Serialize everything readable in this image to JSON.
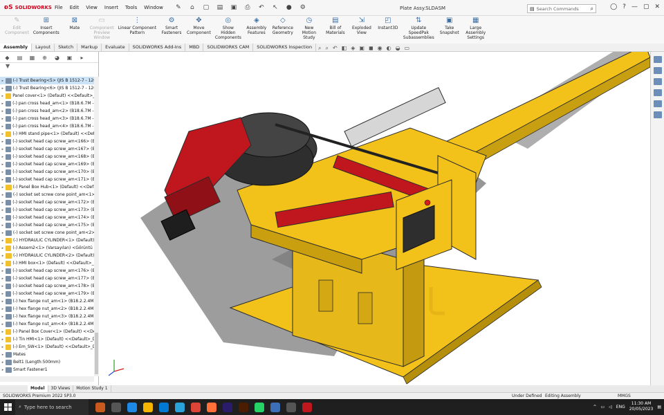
{
  "app": {
    "brand": "SOLIDWORKS",
    "doc_title": "Plate Assy.SLDASM"
  },
  "menus": [
    "File",
    "Edit",
    "View",
    "Insert",
    "Tools",
    "Window"
  ],
  "search": {
    "placeholder": "Search Commands"
  },
  "ribbon": [
    {
      "label": "Edit\nComponent",
      "disabled": true,
      "icon": "edit-component-icon"
    },
    {
      "label": "Insert\nComponents",
      "disabled": false,
      "icon": "insert-components-icon"
    },
    {
      "label": "Mate",
      "disabled": false,
      "icon": "mate-icon"
    },
    {
      "label": "Component\nPreview\nWindow",
      "disabled": true,
      "icon": "preview-window-icon"
    },
    {
      "label": "Linear Component\nPattern",
      "disabled": false,
      "icon": "pattern-icon"
    },
    {
      "label": "Smart\nFasteners",
      "disabled": false,
      "icon": "smart-fasteners-icon"
    },
    {
      "label": "Move\nComponent",
      "disabled": false,
      "icon": "move-component-icon"
    },
    {
      "label": "Show\nHidden\nComponents",
      "disabled": false,
      "icon": "show-hidden-icon"
    },
    {
      "label": "Assembly\nFeatures",
      "disabled": false,
      "icon": "assembly-features-icon"
    },
    {
      "label": "Reference\nGeometry",
      "disabled": false,
      "icon": "reference-geometry-icon"
    },
    {
      "label": "New\nMotion\nStudy",
      "disabled": false,
      "icon": "motion-study-icon"
    },
    {
      "label": "Bill of\nMaterials",
      "disabled": false,
      "icon": "bom-icon"
    },
    {
      "label": "Exploded\nView",
      "disabled": false,
      "icon": "exploded-view-icon"
    },
    {
      "label": "Instant3D",
      "disabled": false,
      "icon": "instant3d-icon"
    },
    {
      "label": "Update\nSpeedPak\nSubassemblies",
      "disabled": false,
      "icon": "speedpak-icon"
    },
    {
      "label": "Take\nSnapshot",
      "disabled": false,
      "icon": "snapshot-icon"
    },
    {
      "label": "Large\nAssembly\nSettings",
      "disabled": false,
      "icon": "large-assembly-icon"
    }
  ],
  "command_tabs": [
    "Assembly",
    "Layout",
    "Sketch",
    "Markup",
    "Evaluate",
    "SOLIDWORKS Add-Ins",
    "MBD",
    "SOLIDWORKS CAM",
    "SOLIDWORKS Inspection"
  ],
  "tree": [
    {
      "t": "(-) Trust Bearing<5> (JIS B 1512-7 - 120",
      "k": "part",
      "sel": true
    },
    {
      "t": "(-) Trust Bearing<6> (JIS B 1512-7 - 120",
      "k": "part"
    },
    {
      "t": "Panel cover<1> (Default) <<Default>_D",
      "k": "asm"
    },
    {
      "t": "(-) pan cross head_am<1> (B18.6.7M - M",
      "k": "part"
    },
    {
      "t": "(-) pan cross head_am<2> (B18.6.7M - M",
      "k": "part"
    },
    {
      "t": "(-) pan cross head_am<3> (B18.6.7M - M",
      "k": "part"
    },
    {
      "t": "(-) pan cross head_am<4> (B18.6.7M - M",
      "k": "part"
    },
    {
      "t": "(-) HMI stand pipe<1> (Default) <<Defa",
      "k": "asm"
    },
    {
      "t": "(-) socket head cap screw_am<166> (B1",
      "k": "part"
    },
    {
      "t": "(-) socket head cap screw_am<167> (B1",
      "k": "part"
    },
    {
      "t": "(-) socket head cap screw_am<168> (B1",
      "k": "part"
    },
    {
      "t": "(-) socket head cap screw_am<169> (B1",
      "k": "part"
    },
    {
      "t": "(-) socket head cap screw_am<170> (B1",
      "k": "part"
    },
    {
      "t": "(-) socket head cap screw_am<171> (B1",
      "k": "part"
    },
    {
      "t": "(-) Panel Box Hub<1> (Default) <<Defa",
      "k": "asm"
    },
    {
      "t": "(-) socket set screw cone point_am<1>",
      "k": "part"
    },
    {
      "t": "(-) socket head cap screw_am<172> (B1",
      "k": "part"
    },
    {
      "t": "(-) socket head cap screw_am<173> (B1",
      "k": "part"
    },
    {
      "t": "(-) socket head cap screw_am<174> (B1",
      "k": "part"
    },
    {
      "t": "(-) socket head cap screw_am<175> (B1",
      "k": "part"
    },
    {
      "t": "(-) socket set screw cone point_am<2>",
      "k": "part"
    },
    {
      "t": "(-) HYDRAULIC CYLINDER<1> (Default)",
      "k": "asm"
    },
    {
      "t": "(-) Assem2<1> (Varsayılan) <Görüntü D",
      "k": "asm"
    },
    {
      "t": "(-) HYDRAULIC CYLINDER<2> (Default)",
      "k": "asm"
    },
    {
      "t": "(-) HMI box<1> (Default) <<Default>_D",
      "k": "asm"
    },
    {
      "t": "(-) socket head cap screw_am<176> (B1",
      "k": "part"
    },
    {
      "t": "(-) socket head cap screw_am<177> (B1",
      "k": "part"
    },
    {
      "t": "(-) socket head cap screw_am<178> (B1",
      "k": "part"
    },
    {
      "t": "(-) socket head cap screw_am<179> (B1",
      "k": "part"
    },
    {
      "t": "(-) hex flange nut_am<1> (B18.2.2.4M -",
      "k": "part"
    },
    {
      "t": "(-) hex flange nut_am<2> (B18.2.2.4M -",
      "k": "part"
    },
    {
      "t": "(-) hex flange nut_am<3> (B18.2.2.4M -",
      "k": "part"
    },
    {
      "t": "(-) hex flange nut_am<4> (B18.2.2.4M -",
      "k": "part"
    },
    {
      "t": "(-) Panel Box Cover<1> (Default) <<Def",
      "k": "asm"
    },
    {
      "t": "(-) Tin HMI<1> (Default) <<Default>_Di",
      "k": "asm"
    },
    {
      "t": "(-) Em_SW<1> (Default) <<Default>_Di",
      "k": "asm"
    },
    {
      "t": "Mates",
      "k": "mates"
    },
    {
      "t": "Belt1 (Length:500mm)",
      "k": "part"
    },
    {
      "t": "Smart Fastener1",
      "k": "part"
    }
  ],
  "bottom_tabs": [
    "Model",
    "3D Views",
    "Motion Study 1"
  ],
  "status": {
    "left": "SOLIDWORKS Premium 2022 SP3.0",
    "state": "Under Defined",
    "mode": "Editing Assembly",
    "units": "MMGS"
  },
  "taskbar": {
    "search": "Type here to search",
    "lang": "ENG",
    "time": "11:30 AM",
    "date": "20/05/2023"
  },
  "colors": {
    "machine_yellow": "#f2c21a",
    "machine_red": "#c0161e",
    "dark": "#2b2b2b"
  }
}
